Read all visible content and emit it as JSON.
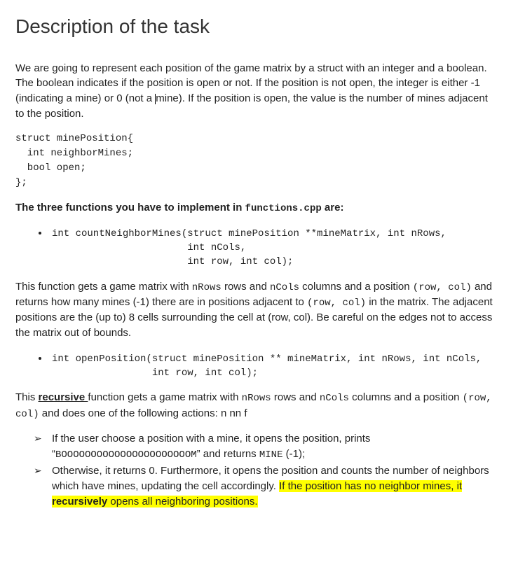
{
  "title": "Description of the task",
  "intro": {
    "p1_a": "We are going to represent each position of the game matrix by a struct with an integer and a boolean. The boolean indicates if the position is open or not. If the position is not open, the integer is either -1 (indicating a mine) or 0 (not a ",
    "p1_b": "mine). If the position is open, the value is the number of mines adjacent to the position."
  },
  "struct_code": "struct minePosition{\n  int neighborMines;\n  bool open;\n};",
  "funcs_heading_a": "The three functions you have to implement in ",
  "funcs_heading_file": "functions.cpp",
  "funcs_heading_b": " are",
  "func1_sig": "int countNeighborMines(struct minePosition **mineMatrix, int nRows,\n                       int nCols,\n                       int row, int col);",
  "func1_desc_a": "This function gets a game matrix with ",
  "func1_nrows": "nRows",
  "func1_desc_b": " rows and ",
  "func1_ncols": "nCols",
  "func1_desc_c": " columns and a position ",
  "func1_rowcol": "(row, col)",
  "func1_desc_d": " and returns how many mines (-1) there are in positions adjacent to ",
  "func1_rowcol2": "(row, col)",
  "func1_desc_e": " in the matrix. The adjacent positions are the (up to) 8 cells surrounding the cell at (row, col).  Be careful on the edges not to access the matrix out of bounds.",
  "func2_sig": "int openPosition(struct minePosition ** mineMatrix, int nRows, int nCols,\n                 int row, int col);",
  "func2_desc_a": "This ",
  "func2_recursive": "recursive ",
  "func2_desc_b": "function gets a game matrix with ",
  "func2_nrows": "nRows",
  "func2_desc_c": " rows and ",
  "func2_ncols": "nCols",
  "func2_desc_d": " columns and a position ",
  "func2_rowcol": "(row, col)",
  "func2_desc_e": " and does one of the following actions:  n nn   f",
  "action1_a": "If the user choose a position with a mine, it opens the position, prints “",
  "action1_boom": "BOOOOOOOOOOOOOOOOOOOOOOM",
  "action1_b": "” and returns ",
  "action1_mine": "MINE",
  "action1_c": " (-1);",
  "action2_a": "Otherwise, it returns 0. Furthermore, it opens the position and counts the number of neighbors which have mines, updating the cell accordingly. ",
  "action2_hl_a": "If the position has no neighbor mines, it ",
  "action2_hl_rec": "recursively",
  "action2_hl_b": " opens all neighboring positions."
}
